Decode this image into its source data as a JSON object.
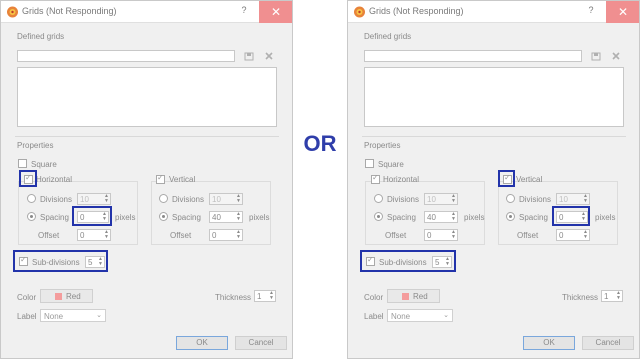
{
  "separator_text": "OR",
  "colors": {
    "highlight": "#2233aa",
    "or_text": "#2f3eaa",
    "close_button": "#f08f90",
    "red_swatch": "#f49c9c"
  },
  "dialogs": [
    {
      "title": "Grids (Not Responding)",
      "help_label": "?",
      "close_label": "✕",
      "defined_grids_label": "Defined grids",
      "properties_label": "Properties",
      "square_label": "Square",
      "square_checked": false,
      "horizontal": {
        "label": "Horizontal",
        "checked": true,
        "divisions_label": "Divisions",
        "divisions_value": "10",
        "spacing_label": "Spacing",
        "spacing_value": "0",
        "spacing_unit": "pixels",
        "offset_label": "Offset",
        "offset_value": "0",
        "selected_mode": "spacing"
      },
      "vertical": {
        "label": "Vertical",
        "checked": true,
        "divisions_label": "Divisions",
        "divisions_value": "10",
        "spacing_label": "Spacing",
        "spacing_value": "40",
        "spacing_unit": "pixels",
        "offset_label": "Offset",
        "offset_value": "0",
        "selected_mode": "spacing"
      },
      "subdivisions": {
        "label": "Sub-divisions",
        "checked": true,
        "value": "5"
      },
      "color_label": "Color",
      "color_value": "Red",
      "thickness_label": "Thickness",
      "thickness_value": "1",
      "label_label": "Label",
      "label_value": "None",
      "ok_label": "OK",
      "cancel_label": "Cancel",
      "highlighted": [
        "horizontal-checkbox",
        "horizontal-spacing-field",
        "subdivisions-row"
      ]
    },
    {
      "title": "Grids (Not Responding)",
      "help_label": "?",
      "close_label": "✕",
      "defined_grids_label": "Defined grids",
      "properties_label": "Properties",
      "square_label": "Square",
      "square_checked": false,
      "horizontal": {
        "label": "Horizontal",
        "checked": true,
        "divisions_label": "Divisions",
        "divisions_value": "10",
        "spacing_label": "Spacing",
        "spacing_value": "40",
        "spacing_unit": "pixels",
        "offset_label": "Offset",
        "offset_value": "0",
        "selected_mode": "spacing"
      },
      "vertical": {
        "label": "Vertical",
        "checked": true,
        "divisions_label": "Divisions",
        "divisions_value": "10",
        "spacing_label": "Spacing",
        "spacing_value": "0",
        "spacing_unit": "pixels",
        "offset_label": "Offset",
        "offset_value": "0",
        "selected_mode": "spacing"
      },
      "subdivisions": {
        "label": "Sub-divisions",
        "checked": true,
        "value": "5"
      },
      "color_label": "Color",
      "color_value": "Red",
      "thickness_label": "Thickness",
      "thickness_value": "1",
      "label_label": "Label",
      "label_value": "None",
      "ok_label": "OK",
      "cancel_label": "Cancel",
      "highlighted": [
        "vertical-checkbox",
        "vertical-spacing-field",
        "subdivisions-row"
      ]
    }
  ]
}
